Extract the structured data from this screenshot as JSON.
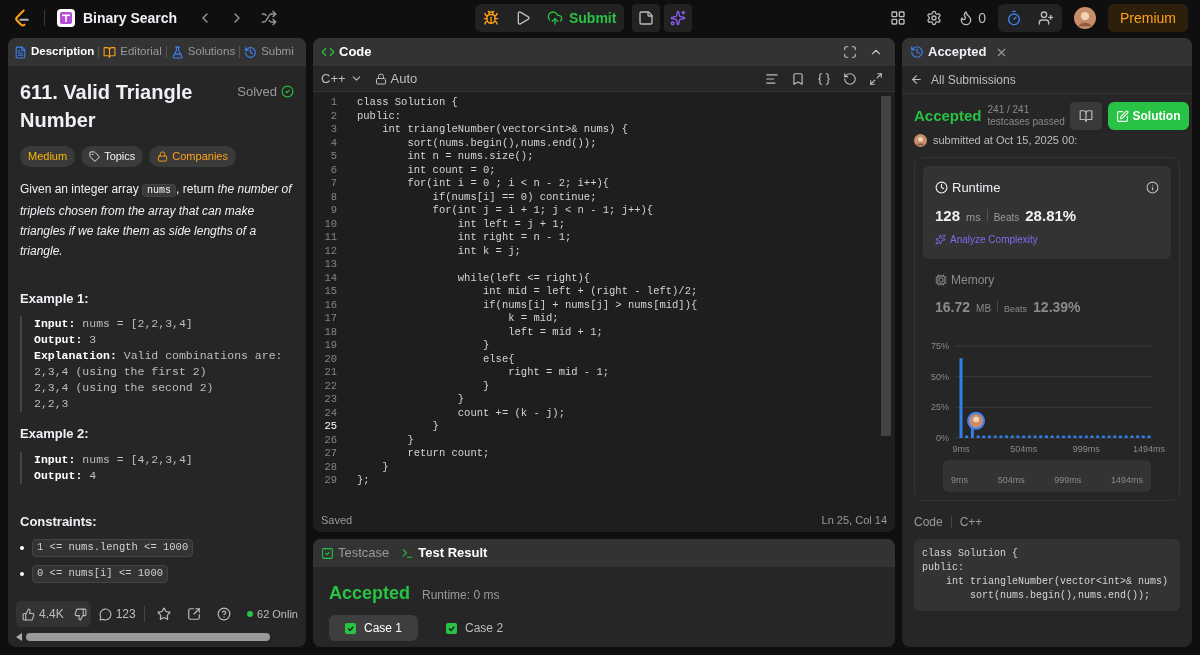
{
  "topbar": {
    "problem_list": "Binary Search",
    "submit": "Submit",
    "streak": "0",
    "premium": "Premium"
  },
  "left": {
    "tabs": [
      {
        "label": "Description",
        "selected": true
      },
      {
        "label": "Editorial",
        "selected": false
      },
      {
        "label": "Solutions",
        "selected": false
      },
      {
        "label": "Submi",
        "selected": false
      }
    ],
    "title": "611. Valid Triangle Number",
    "status": "Solved",
    "tags": [
      {
        "label": "Medium",
        "kind": "difficulty"
      },
      {
        "label": "Topics",
        "kind": "topics"
      },
      {
        "label": "Companies",
        "kind": "companies"
      }
    ],
    "description": {
      "before": "Given an integer array ",
      "code": "nums",
      "after": ", return *the number of triplets chosen from the array that can make triangles if we take them as side lengths of a triangle.*"
    },
    "examples": [
      {
        "title": "Example 1:",
        "lines": [
          "**Input:** nums = [2,2,3,4]",
          "**Output:** 3",
          "**Explanation:** Valid combinations are:",
          "2,3,4 (using the first 2)",
          "2,3,4 (using the second 2)",
          "2,2,3"
        ]
      },
      {
        "title": "Example 2:",
        "lines": [
          "**Input:** nums = [4,2,3,4]",
          "**Output:** 4"
        ]
      }
    ],
    "constraints_title": "Constraints:",
    "constraints": [
      "1 <= nums.length <= 1000",
      "0 <= nums[i] <= 1000"
    ],
    "footer": {
      "likes": "4.4K",
      "comments": "123",
      "online": "62 Onlin"
    }
  },
  "editor": {
    "title": "Code",
    "language": "C++",
    "mode": "Auto",
    "lines": [
      {
        "number": "1",
        "text": "class Solution {",
        "current": false
      },
      {
        "number": "2",
        "text": "public:",
        "current": false
      },
      {
        "number": "3",
        "text": "    int triangleNumber(vector<int>& nums) {",
        "current": false
      },
      {
        "number": "4",
        "text": "        sort(nums.begin(),nums.end());",
        "current": false
      },
      {
        "number": "5",
        "text": "        int n = nums.size();",
        "current": false
      },
      {
        "number": "6",
        "text": "        int count = 0;",
        "current": false
      },
      {
        "number": "7",
        "text": "        for(int i = 0 ; i < n - 2; i++){",
        "current": false
      },
      {
        "number": "8",
        "text": "            if(nums[i] == 0) continue;",
        "current": false
      },
      {
        "number": "9",
        "text": "            for(int j = i + 1; j < n - 1; j++){",
        "current": false
      },
      {
        "number": "10",
        "text": "                int left = j + 1;",
        "current": false
      },
      {
        "number": "11",
        "text": "                int right = n - 1;",
        "current": false
      },
      {
        "number": "12",
        "text": "                int k = j;",
        "current": false
      },
      {
        "number": "13",
        "current": false
      },
      {
        "number": "14",
        "text": "                while(left <= right){",
        "current": false
      },
      {
        "number": "15",
        "text": "                    int mid = left + (right - left)/2;",
        "current": false
      },
      {
        "number": "16",
        "text": "                    if(nums[i] + nums[j] > nums[mid]){",
        "current": false
      },
      {
        "number": "17",
        "text": "                        k = mid;",
        "current": false
      },
      {
        "number": "18",
        "text": "                        left = mid + 1;",
        "current": false
      },
      {
        "number": "19",
        "text": "                    }",
        "current": false
      },
      {
        "number": "20",
        "text": "                    else{",
        "current": false
      },
      {
        "number": "21",
        "text": "                        right = mid - 1;",
        "current": false
      },
      {
        "number": "22",
        "text": "                    }",
        "current": false
      },
      {
        "number": "23",
        "text": "                }",
        "current": false
      },
      {
        "number": "24",
        "text": "                count += (k - j);",
        "current": false
      },
      {
        "number": "25",
        "text": "            }",
        "current": true
      },
      {
        "number": "26",
        "text": "        }",
        "current": false
      },
      {
        "number": "27",
        "text": "        return count;",
        "current": false
      },
      {
        "number": "28",
        "text": "    }",
        "current": false
      },
      {
        "number": "29",
        "text": "};",
        "current": false
      }
    ],
    "status": "Saved",
    "cursor": "Ln 25, Col 14"
  },
  "testpanel": {
    "tabs": [
      {
        "label": "Testcase",
        "selected": false
      },
      {
        "label": "Test Result",
        "selected": true
      }
    ],
    "result": "Accepted",
    "runtime": "Runtime: 0 ms",
    "cases": [
      {
        "label": "Case 1",
        "selected": true
      },
      {
        "label": "Case 2",
        "selected": false
      }
    ]
  },
  "submission": {
    "tab": "Accepted",
    "back": "All Submissions",
    "verdict": "Accepted",
    "testcases": "241 / 241 testcases passed",
    "solution_button": "Solution",
    "submitted": "submitted at Oct 15, 2025 00:",
    "runtime": {
      "title": "Runtime",
      "value": "128",
      "unit": "ms",
      "beats_label": "Beats",
      "beats": "28.81%",
      "analyze": "Analyze Complexity"
    },
    "memory": {
      "title": "Memory",
      "value": "16.72",
      "unit": "MB",
      "beats_label": "Beats",
      "beats": "12.39%"
    },
    "chart_data": {
      "type": "bar",
      "x": [
        9,
        54,
        99,
        144,
        189,
        234,
        279,
        324,
        369,
        414,
        459,
        504,
        549,
        594,
        639,
        684,
        729,
        774,
        819,
        864,
        909,
        954,
        999,
        1044,
        1089,
        1134,
        1179,
        1224,
        1269,
        1314,
        1359,
        1404,
        1449,
        1494
      ],
      "series": [
        {
          "color": "#2f80ed",
          "values": [
            65,
            2,
            8,
            2,
            2,
            2,
            2,
            2,
            2,
            2,
            2,
            2,
            2,
            2,
            2,
            2,
            2,
            2,
            2,
            2,
            2,
            2,
            2,
            2,
            2,
            2,
            2,
            2,
            2,
            2,
            2,
            2,
            2,
            2
          ]
        }
      ],
      "xlim": [
        9,
        1494
      ],
      "ylim": [
        0,
        75
      ],
      "yticks": [
        {
          "value": 0,
          "label": "0%"
        },
        {
          "value": 25,
          "label": "25%"
        },
        {
          "value": 50,
          "label": "50%"
        },
        {
          "value": 75,
          "label": "75%"
        }
      ],
      "xticks": [
        {
          "value": 9,
          "label": "9ms"
        },
        {
          "value": 504,
          "label": "504ms"
        },
        {
          "value": 999,
          "label": "999ms"
        },
        {
          "value": 1494,
          "label": "1494ms"
        }
      ]
    },
    "overview_labels": [
      "9ms",
      "504ms",
      "999ms",
      "1494ms"
    ],
    "code_label": "Code",
    "code_language": "C++",
    "code_lines": [
      "class Solution {",
      "public:",
      "    int triangleNumber(vector<int>& nums)",
      "        sort(nums.begin(),nums.end());"
    ]
  }
}
